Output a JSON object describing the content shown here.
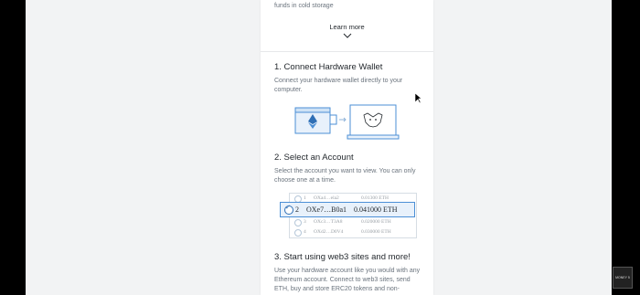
{
  "top": {
    "partial_text": "funds in cold storage"
  },
  "learn_more": {
    "label": "Learn more"
  },
  "section1": {
    "title": "1. Connect Hardware Wallet",
    "description": "Connect your hardware wallet directly to your computer."
  },
  "section2": {
    "title": "2. Select an Account",
    "description": "Select the account you want to view. You can only choose one at a time.",
    "accounts": [
      {
        "num": "1",
        "address": "OXa4…ela2",
        "balance": "0.01300 ETH"
      },
      {
        "num": "2",
        "address": "OXe7…B0a1",
        "balance": "0.041000 ETH",
        "selected": true
      },
      {
        "num": "3",
        "address": "OXc3…T3A8",
        "balance": "0.020000 ETH"
      },
      {
        "num": "4",
        "address": "OXd2…D0V4",
        "balance": "0.030000 ETH"
      }
    ]
  },
  "section3": {
    "title": "3. Start using web3 sites and more!",
    "description": "Use your hardware account like you would with any Ethereum account. Connect to web3 sites, send ETH, buy and store ERC20 tokens and non-"
  },
  "badge": {
    "text": "MONEY 5"
  },
  "colors": {
    "accent": "#4b8fd6",
    "selected_bg": "#e8f1fb",
    "panel_bg": "#ffffff",
    "page_bg": "#f2f3f4"
  }
}
